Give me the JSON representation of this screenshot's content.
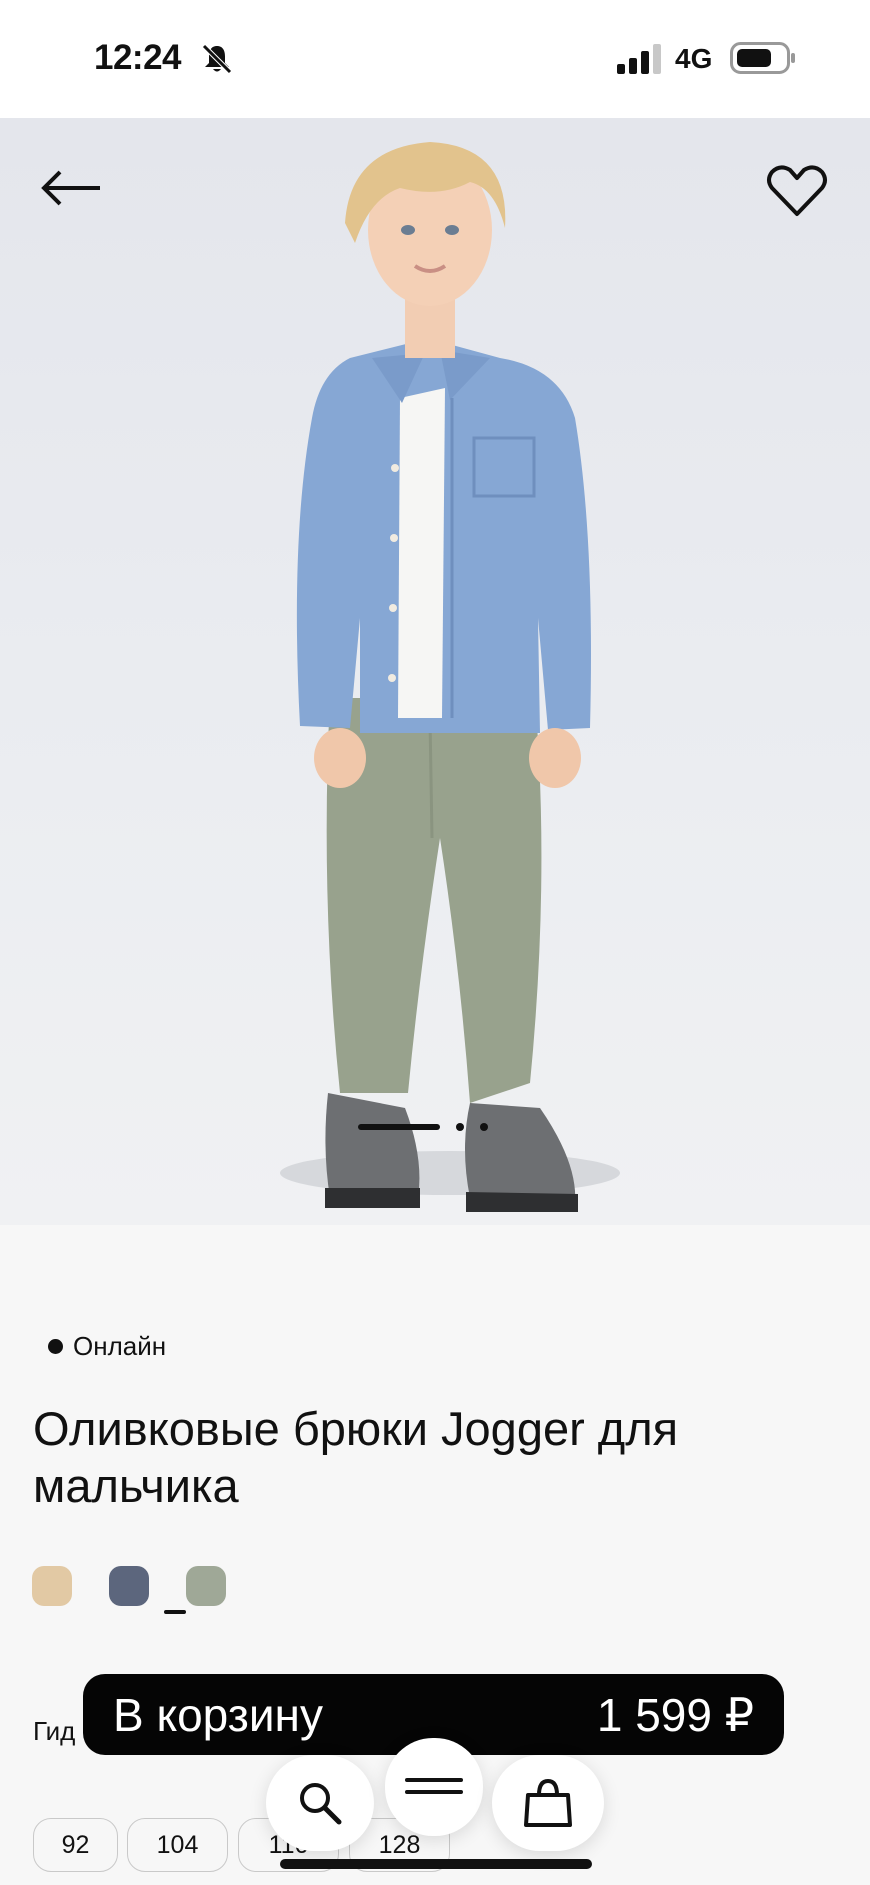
{
  "status_bar": {
    "time": "12:24",
    "network": "4G"
  },
  "product": {
    "availability": "Онлайн",
    "title": "Оливковые брюки Jogger для мальчика",
    "color_swatches": [
      {
        "name": "beige",
        "color": "#e2c9a4"
      },
      {
        "name": "navy",
        "color": "#5c667d"
      },
      {
        "name": "olive",
        "color": "#9fa897",
        "selected": true
      }
    ]
  },
  "size_guide": {
    "label": "Гид"
  },
  "sizes": [
    "92",
    "104",
    "116",
    "128"
  ],
  "cart": {
    "label": "В корзину",
    "price": "1 599 ₽"
  },
  "icons": {
    "back": "arrow-left-icon",
    "favorite": "heart-icon",
    "search": "search-icon",
    "menu": "menu-icon",
    "bag": "shopping-bag-icon"
  },
  "colors": {
    "accent": "#050505",
    "background": "#f7f7f7"
  }
}
